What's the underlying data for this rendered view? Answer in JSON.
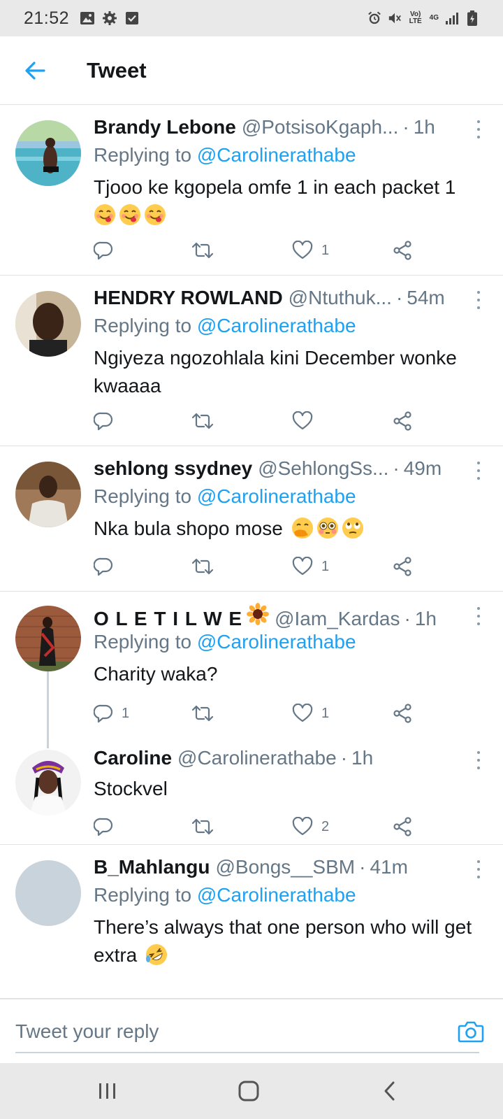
{
  "status_bar": {
    "time": "21:52",
    "left_icons": [
      "image-icon",
      "gear-icon",
      "check-box-icon"
    ],
    "right_icons": [
      "alarm-icon",
      "mute-icon",
      "volte-icon",
      "4g-icon",
      "signal-icon",
      "battery-icon"
    ],
    "volte_label": "Vo) LTE",
    "network_label": "4G"
  },
  "appbar": {
    "back_icon": "back-arrow-icon",
    "title": "Tweet"
  },
  "tweets": [
    {
      "name": "Brandy Lebone",
      "handle": "@PotsisoKgaph...",
      "time": "1h",
      "replying_prefix": "Replying to ",
      "replying_to": "@Carolinerathabe",
      "text": "Tjooo ke kgopela omfe 1 in each packet 1",
      "emojis": [
        "face-savoring-food",
        "face-savoring-food",
        "face-savoring-food"
      ],
      "reply_count": "",
      "retweet_count": "",
      "like_count": "1"
    },
    {
      "name": "HENDRY ROWLAND",
      "handle": "@Ntuthuk...",
      "time": "54m",
      "replying_prefix": "Replying to ",
      "replying_to": "@Carolinerathabe",
      "text": "Ngiyeza ngozohlala kini December wonke kwaaaa",
      "emojis": [],
      "reply_count": "",
      "retweet_count": "",
      "like_count": ""
    },
    {
      "name": "sehlong ssydney",
      "handle": "@SehlongSs...",
      "time": "49m",
      "replying_prefix": "Replying to ",
      "replying_to": "@Carolinerathabe",
      "text": "Nka bula shopo mose",
      "emojis": [
        "face-with-hand-over-mouth",
        "flushed-face",
        "face-with-rolling-eyes"
      ],
      "reply_count": "",
      "retweet_count": "",
      "like_count": "1"
    },
    {
      "name": "O L E T I L W E",
      "name_emoji": "sunflower",
      "handle": "@Iam_Kardas",
      "time": "1h",
      "replying_prefix": "Replying to ",
      "replying_to": "@Carolinerathabe",
      "text": "Charity waka?",
      "emojis": [],
      "reply_count": "1",
      "retweet_count": "",
      "like_count": "1"
    },
    {
      "name": "Caroline",
      "handle": "@Carolinerathabe",
      "time": "1h",
      "text": "Stockvel",
      "emojis": [],
      "reply_count": "",
      "retweet_count": "",
      "like_count": "2"
    },
    {
      "name": "B_Mahlangu",
      "handle": "@Bongs__SBM",
      "time": "41m",
      "replying_prefix": "Replying to ",
      "replying_to": "@Carolinerathabe",
      "text": "There’s always that one person who will get extra",
      "emojis": [
        "rolling-on-the-floor-laughing"
      ],
      "reply_count": "",
      "retweet_count": "",
      "like_count": ""
    }
  ],
  "composer": {
    "placeholder": "Tweet your reply",
    "camera_icon": "camera-icon"
  },
  "nav_bar": {
    "icons": [
      "recent-apps-icon",
      "home-icon",
      "back-icon"
    ]
  },
  "colors": {
    "accent": "#1da1f2",
    "secondary_text": "#657786",
    "divider": "#dfe3e6",
    "system_bar": "#e9e9ea"
  }
}
